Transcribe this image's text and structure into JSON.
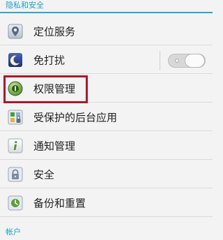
{
  "sections": [
    {
      "title": "隐私和安全"
    },
    {
      "title": "帐户"
    }
  ],
  "items": [
    {
      "label": "定位服务",
      "icon": "location-pin-icon"
    },
    {
      "label": "免打扰",
      "icon": "moon-icon",
      "toggle": {
        "state": "off"
      }
    },
    {
      "label": "权限管理",
      "icon": "permission-shield-icon",
      "highlighted": true
    },
    {
      "label": "受保护的后台应用",
      "icon": "protected-apps-icon"
    },
    {
      "label": "通知管理",
      "icon": "info-icon"
    },
    {
      "label": "安全",
      "icon": "lock-icon"
    },
    {
      "label": "备份和重置",
      "icon": "backup-icon"
    }
  ],
  "colors": {
    "section_accent": "#2aa6d0",
    "highlight_border": "#b1152a"
  }
}
